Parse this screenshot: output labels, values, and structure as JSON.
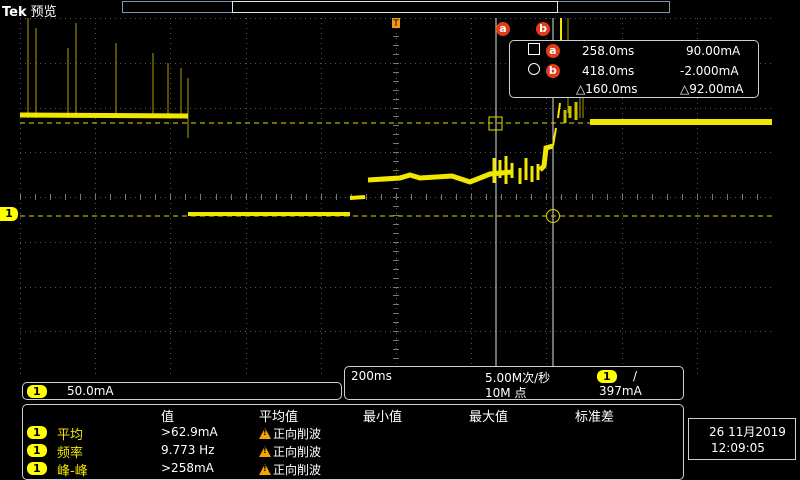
{
  "header": {
    "brand": "Tek",
    "mode": "预览"
  },
  "cursors": {
    "a_tag": "a",
    "b_tag": "b",
    "a_time": "258.0ms",
    "a_value": "90.00mA",
    "b_time": "418.0ms",
    "b_value": "-2.000mA",
    "delta_time": "△160.0ms",
    "delta_value": "△92.00mA"
  },
  "channel": {
    "number": "1",
    "scale": "50.0mA",
    "color": "#ffff00"
  },
  "horizontal": {
    "time_per_div": "200ms",
    "sample_rate": "5.00M次/秒",
    "record_length": "10M 点",
    "trigger_source": "1",
    "trigger_slope": "/",
    "trigger_level": "397mA"
  },
  "measurements": {
    "headers": [
      "值",
      "平均值",
      "最小值",
      "最大值",
      "标准差"
    ],
    "rows": [
      {
        "channel": "1",
        "name": "平均",
        "value": ">62.9mA",
        "status": "正向削波"
      },
      {
        "channel": "1",
        "name": "频率",
        "value": "9.773 Hz",
        "status": "正向削波"
      },
      {
        "channel": "1",
        "name": "峰-峰",
        "value": ">258mA",
        "status": "正向削波"
      }
    ]
  },
  "datetime": {
    "date": "26 11月2019",
    "time": "12:09:05"
  },
  "markers": {
    "ground": "1"
  }
}
